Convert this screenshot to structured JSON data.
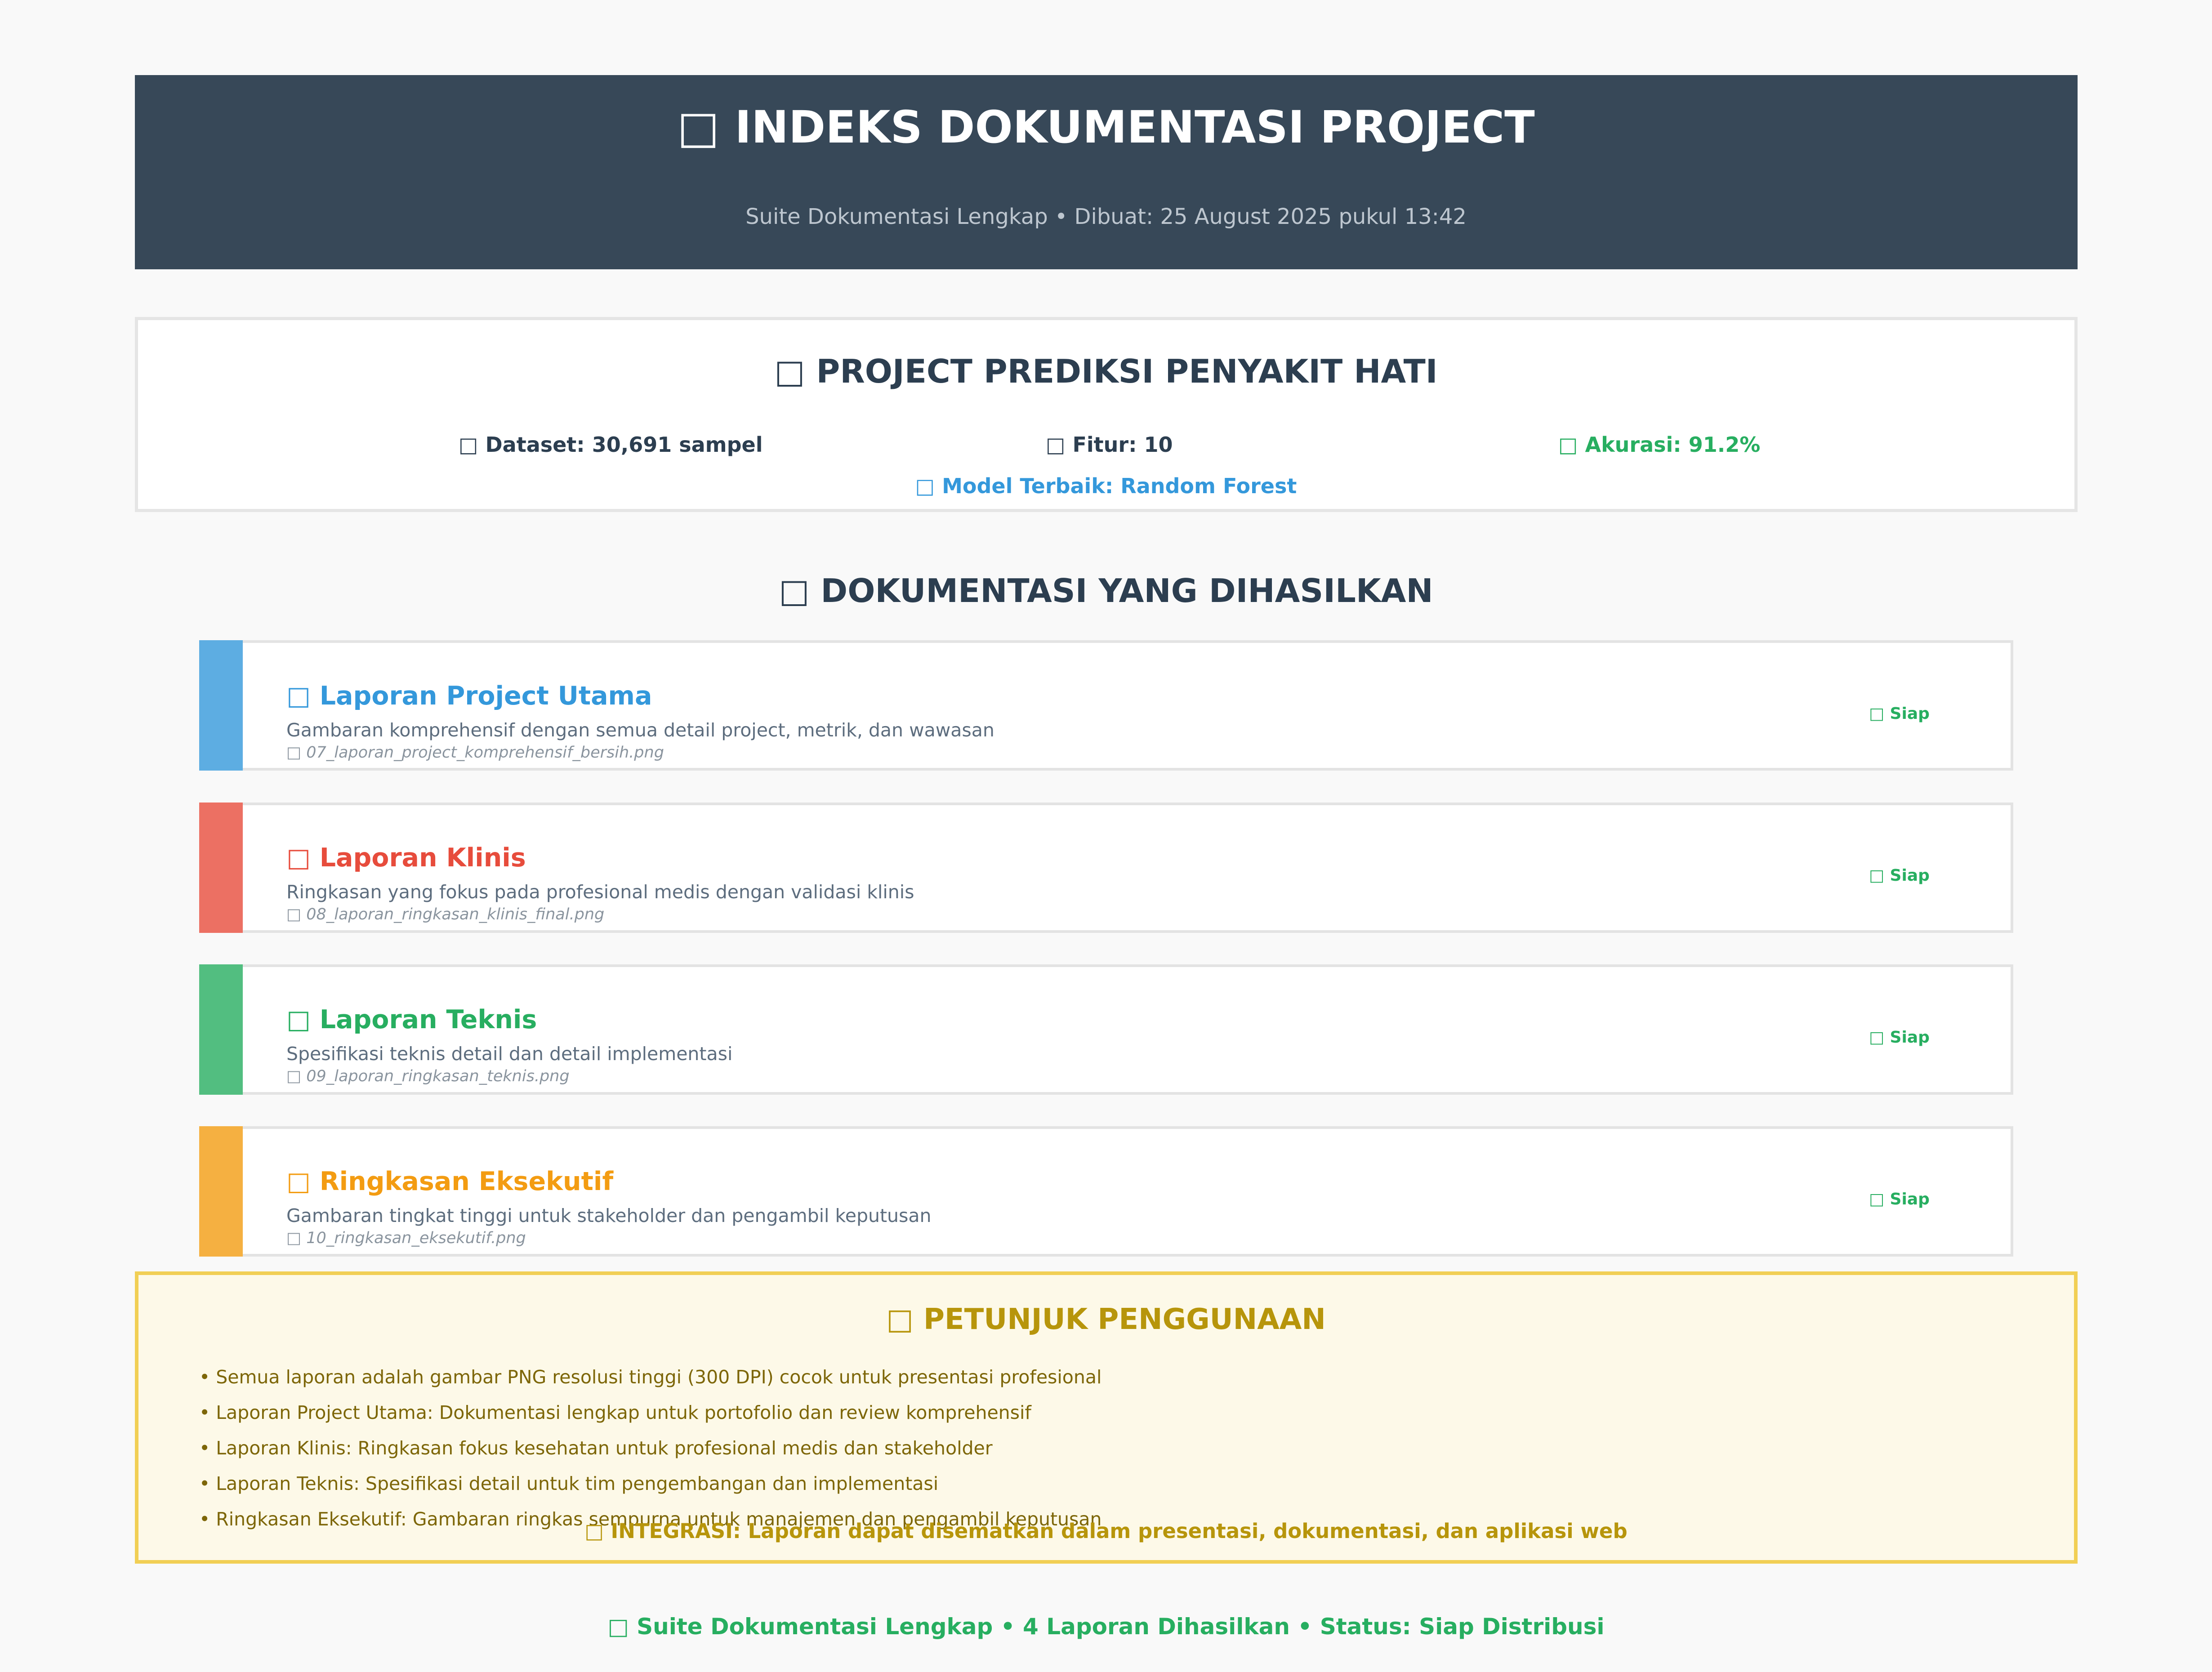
{
  "header": {
    "icon": "book-icon",
    "title": "□ INDEKS DOKUMENTASI PROJECT",
    "subtitle": "Suite Dokumentasi Lengkap • Dibuat: 25 August 2025 pukul 13:42",
    "background_color": "#374858"
  },
  "project": {
    "title": "□ PROJECT PREDIKSI PENYAKIT HATI",
    "stats": {
      "dataset": "□ Dataset: 30,691 sampel",
      "fitur": "□ Fitur: 10",
      "akurasi": "□ Akurasi: 91.2%",
      "model": "□ Model Terbaik: Random Forest"
    }
  },
  "docs": {
    "section_title": "□ DOKUMENTASI YANG DIHASILKAN",
    "items": [
      {
        "title": "□ Laporan Project Utama",
        "description": "Gambaran komprehensif dengan semua detail project, metrik, dan wawasan",
        "file": "□ 07_laporan_project_komprehensif_bersih.png",
        "status": "□ Siap",
        "color": "#3498db",
        "bar_color": "#5dade2"
      },
      {
        "title": "□ Laporan Klinis",
        "description": "Ringkasan yang fokus pada profesional medis dengan validasi klinis",
        "file": "□ 08_laporan_ringkasan_klinis_final.png",
        "status": "□ Siap",
        "color": "#e74c3c",
        "bar_color": "#ec7063"
      },
      {
        "title": "□ Laporan Teknis",
        "description": "Spesifikasi teknis detail dan detail implementasi",
        "file": "□ 09_laporan_ringkasan_teknis.png",
        "status": "□ Siap",
        "color": "#27ae60",
        "bar_color": "#52be80"
      },
      {
        "title": "□ Ringkasan Eksekutif",
        "description": "Gambaran tingkat tinggi untuk stakeholder dan pengambil keputusan",
        "file": "□ 10_ringkasan_eksekutif.png",
        "status": "□ Siap",
        "color": "#f39c12",
        "bar_color": "#f5b041"
      }
    ]
  },
  "guide": {
    "title": "□ PETUNJUK PENGGUNAAN",
    "items": [
      "• Semua laporan adalah gambar PNG resolusi tinggi (300 DPI) cocok untuk presentasi profesional",
      "• Laporan Project Utama: Dokumentasi lengkap untuk portofolio dan review komprehensif",
      "• Laporan Klinis: Ringkasan fokus kesehatan untuk profesional medis dan stakeholder",
      "• Laporan Teknis: Spesifikasi detail untuk tim pengembangan dan implementasi",
      "• Ringkasan Eksekutif: Gambaran ringkas sempurna untuk manajemen dan pengambil keputusan"
    ],
    "integrasi": "□ INTEGRASI: Laporan dapat disematkan dalam presentasi, dokumentasi, dan aplikasi web"
  },
  "footer": {
    "text": "□ Suite Dokumentasi Lengkap • 4 Laporan Dihasilkan • Status: Siap Distribusi"
  }
}
